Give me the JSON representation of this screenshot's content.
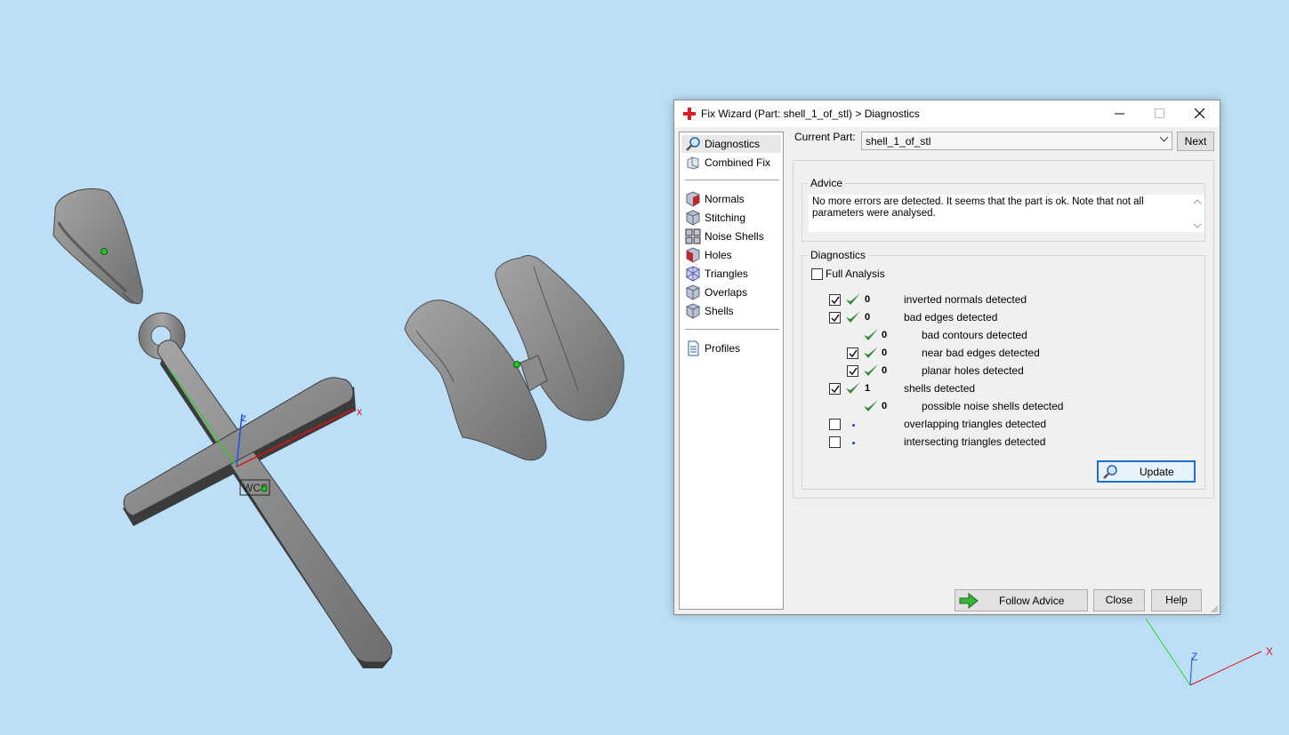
{
  "window": {
    "title": "Fix Wizard (Part: shell_1_of_stl) > Diagnostics"
  },
  "nav": {
    "items_top": [
      {
        "label": "Diagnostics",
        "icon": "magnifier-icon",
        "selected": true
      },
      {
        "label": "Combined Fix",
        "icon": "combined-fix-icon"
      }
    ],
    "items_mid": [
      {
        "label": "Normals",
        "icon": "normals-icon"
      },
      {
        "label": "Stitching",
        "icon": "stitching-icon"
      },
      {
        "label": "Noise Shells",
        "icon": "noise-shells-icon"
      },
      {
        "label": "Holes",
        "icon": "holes-icon"
      },
      {
        "label": "Triangles",
        "icon": "triangles-icon"
      },
      {
        "label": "Overlaps",
        "icon": "overlaps-icon"
      },
      {
        "label": "Shells",
        "icon": "shells-icon"
      }
    ],
    "items_bottom": [
      {
        "label": "Profiles",
        "icon": "profiles-icon"
      }
    ]
  },
  "current_part": {
    "label": "Current Part:",
    "value": "shell_1_of_stl",
    "next_label": "Next"
  },
  "advice": {
    "title": "Advice",
    "text": "No more errors are detected. It seems that the part is ok. Note that not all parameters were analysed."
  },
  "diagnostics": {
    "title": "Diagnostics",
    "full_analysis_label": "Full Analysis",
    "full_analysis_checked": false,
    "rows": [
      {
        "count": "0",
        "label": "inverted normals detected",
        "checked": true
      },
      {
        "count": "0",
        "label": "bad edges detected",
        "checked": true
      },
      {
        "count": "0",
        "label": "bad contours detected"
      },
      {
        "count": "0",
        "label": "near bad edges detected",
        "checked": true
      },
      {
        "count": "0",
        "label": "planar holes detected",
        "checked": true
      },
      {
        "count": "1",
        "label": "shells detected",
        "checked": true
      },
      {
        "count": "0",
        "label": "possible noise shells detected"
      },
      {
        "count": "",
        "label": "overlapping triangles detected",
        "checked": false
      },
      {
        "count": "",
        "label": "intersecting triangles detected",
        "checked": false
      }
    ],
    "update_label": "Update"
  },
  "footer": {
    "follow_advice_label": "Follow Advice",
    "close_label": "Close",
    "help_label": "Help"
  },
  "viewport": {
    "wcs_label": "WCS",
    "axis_x": "x",
    "axis_z": "z",
    "axis_big_x": "X",
    "axis_big_z": "Z",
    "background": "#bcdff7"
  }
}
